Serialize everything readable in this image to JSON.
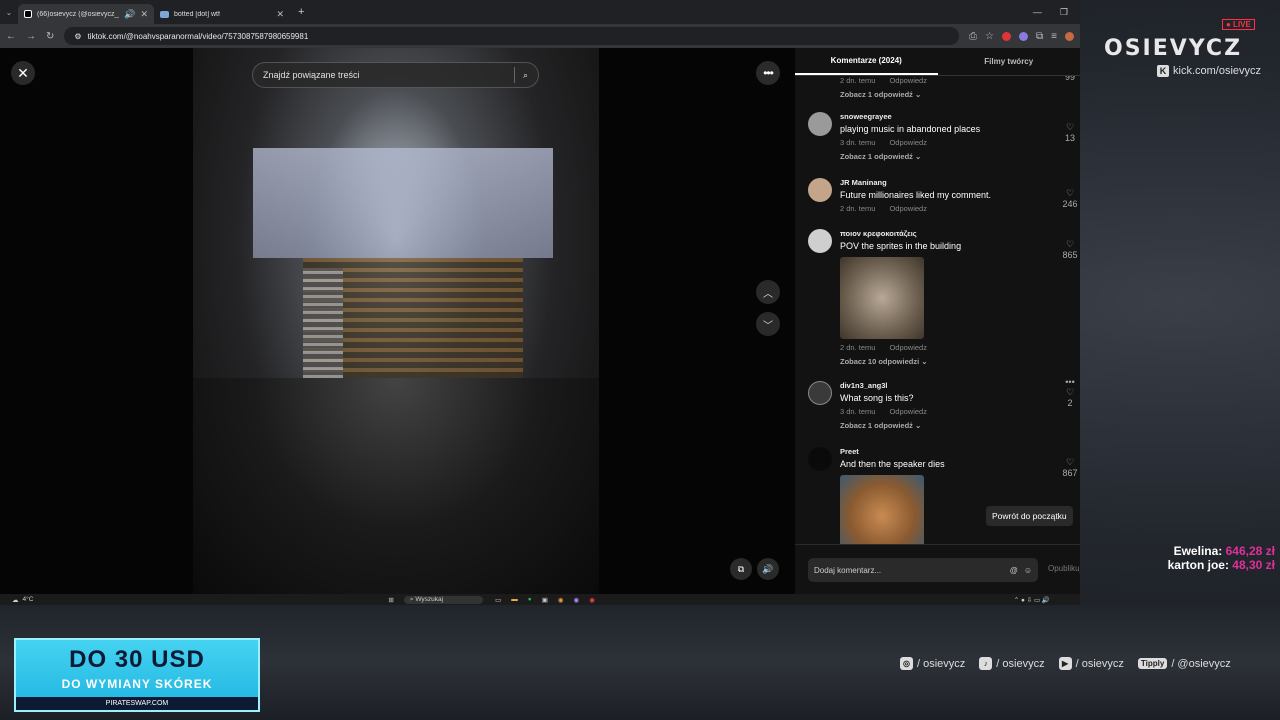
{
  "browser": {
    "tabs": [
      {
        "title": "(66)osievycz (@osievycz_)",
        "active": true
      },
      {
        "title": "botted [dot] wtf",
        "active": false
      }
    ],
    "url": "tiktok.com/@noahvsparanormal/video/7573087587980659981"
  },
  "tiktok": {
    "search_placeholder": "Znajdź powiązane treści",
    "tabs": [
      "Komentarze (2024)",
      "Filmy twórcy"
    ],
    "comments": [
      {
        "user": "",
        "text": "",
        "time": "2 dn. temu",
        "reply": "Odpowiedz",
        "likes": "99",
        "more": "Zobacz 1 odpowiedź"
      },
      {
        "user": "snoweegrayee",
        "text": "playing music in abandoned places",
        "time": "3 dn. temu",
        "reply": "Odpowiedz",
        "likes": "13",
        "more": "Zobacz 1 odpowiedź"
      },
      {
        "user": "JR Maninang",
        "text": "Future millionaires liked my comment.",
        "time": "2 dn. temu",
        "reply": "Odpowiedz",
        "likes": "246",
        "more": ""
      },
      {
        "user": "ποιον κρεφοκοιτάζεις",
        "text": "POV the sprites in the building",
        "time": "2 dn. temu",
        "reply": "Odpowiedz",
        "likes": "865",
        "more": "Zobacz 10 odpowiedzi"
      },
      {
        "user": "div1n3_ang3l",
        "text": "What song is this?",
        "time": "3 dn. temu",
        "reply": "Odpowiedz",
        "likes": "2",
        "more": "Zobacz 1 odpowiedź"
      },
      {
        "user": "Preet",
        "text": "And then the speaker dies",
        "time": "",
        "reply": "",
        "likes": "867",
        "more": ""
      }
    ],
    "back_to_top": "Powrót do początku",
    "comment_placeholder": "Dodaj komentarz...",
    "post": "Opublikuj"
  },
  "taskbar": {
    "weather": "4°C",
    "search": "Wyszukaj"
  },
  "overlay": {
    "live": "● LIVE",
    "logo": "OSIEVYCZ",
    "kick": "kick.com/osievycz",
    "donors": [
      {
        "name": "Ewelina:",
        "amount": "646,28 zł"
      },
      {
        "name": "karton joe:",
        "amount": "48,30 zł"
      }
    ],
    "ad": {
      "line1": "DO 30 USD",
      "line2": "DO WYMIANY SKÓREK",
      "line3": "PIRATESWAP.COM"
    },
    "socials": [
      {
        "icon": "instagram-icon",
        "handle": "/ osievycz"
      },
      {
        "icon": "tiktok-icon",
        "handle": "/ osievycz"
      },
      {
        "icon": "youtube-icon",
        "handle": "/ osievycz"
      },
      {
        "icon": "tipply-icon",
        "label": "Tipply",
        "handle": "/ @osievycz"
      }
    ]
  }
}
